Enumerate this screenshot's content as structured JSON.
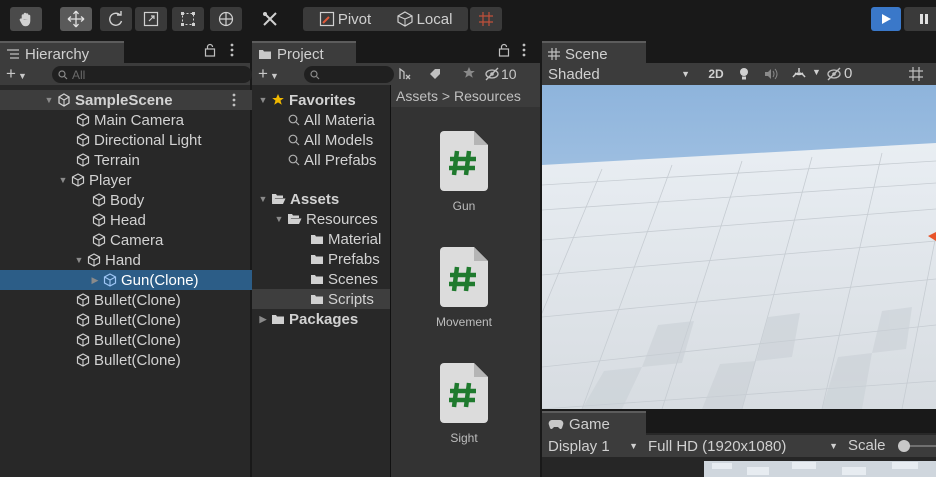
{
  "toolbar": {
    "tools": [
      {
        "name": "hand-tool-icon"
      },
      {
        "name": "move-tool-icon"
      },
      {
        "name": "rotate-tool-icon"
      },
      {
        "name": "scale-tool-icon"
      },
      {
        "name": "rect-tool-icon"
      },
      {
        "name": "transform-tool-icon"
      },
      {
        "name": "custom-tool-icon"
      }
    ],
    "pivot_label": "Pivot",
    "local_label": "Local",
    "accent": "#3a78c9"
  },
  "hierarchy": {
    "tab_label": "Hierarchy",
    "search_placeholder": "All",
    "scene_name": "SampleScene",
    "items": [
      {
        "label": "Main Camera"
      },
      {
        "label": "Directional Light"
      },
      {
        "label": "Terrain"
      },
      {
        "label": "Player"
      },
      {
        "label": "Body"
      },
      {
        "label": "Head"
      },
      {
        "label": "Camera"
      },
      {
        "label": "Hand"
      },
      {
        "label": "Gun(Clone)",
        "selected": true
      },
      {
        "label": "Bullet(Clone)"
      },
      {
        "label": "Bullet(Clone)"
      },
      {
        "label": "Bullet(Clone)"
      },
      {
        "label": "Bullet(Clone)"
      }
    ]
  },
  "project": {
    "tab_label": "Project",
    "hidden_count": "10",
    "breadcrumb": "Assets > Resources",
    "favorites_label": "Favorites",
    "favorites": [
      "All Materia",
      "All Models",
      "All Prefabs"
    ],
    "assets_label": "Assets",
    "resources_label": "Resources",
    "resources_children": [
      "Material",
      "Prefabs",
      "Scenes",
      "Scripts"
    ],
    "packages_label": "Packages",
    "files": [
      {
        "label": "Gun"
      },
      {
        "label": "Movement"
      },
      {
        "label": "Sight"
      }
    ]
  },
  "scene": {
    "tab_label": "Scene",
    "shading": "Shaded",
    "mode_2d": "2D",
    "gizmo_count": "0"
  },
  "game": {
    "tab_label": "Game",
    "display": "Display 1",
    "resolution": "Full HD (1920x1080)",
    "scale_label": "Scale"
  }
}
